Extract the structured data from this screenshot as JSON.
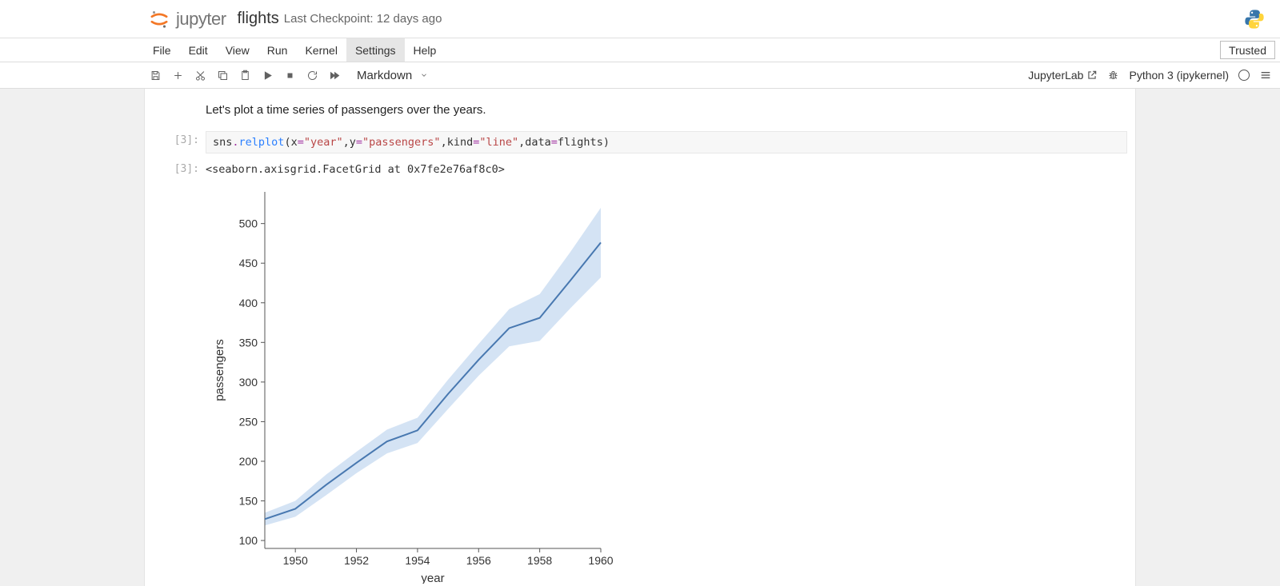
{
  "header": {
    "brand": "jupyter",
    "notebook_name": "flights",
    "checkpoint": "Last Checkpoint: 12 days ago"
  },
  "menu": {
    "items": [
      "File",
      "Edit",
      "View",
      "Run",
      "Kernel",
      "Settings",
      "Help"
    ],
    "active_index": 5,
    "trusted_label": "Trusted"
  },
  "toolbar": {
    "celltype_label": "Markdown",
    "jupyterlab_link": "JupyterLab",
    "kernel_name": "Python 3 (ipykernel)"
  },
  "cells": {
    "markdown_text": "Let's plot a time series of passengers over the years.",
    "in_prompt": "[3]:",
    "out_prompt": "[3]:",
    "code_tokens": {
      "p1": "sns",
      "p2": ".",
      "p3": "relplot",
      "p4": "(x",
      "p5": "=",
      "p6": "\"year\"",
      "p7": ",y",
      "p8": "=",
      "p9": "\"passengers\"",
      "p10": ",kind",
      "p11": "=",
      "p12": "\"line\"",
      "p13": ",data",
      "p14": "=",
      "p15": "flights)"
    },
    "output_text": "<seaborn.axisgrid.FacetGrid at 0x7fe2e76af8c0>"
  },
  "chart_data": {
    "type": "line",
    "xlabel": "year",
    "ylabel": "passengers",
    "x_ticks": [
      1950,
      1952,
      1954,
      1956,
      1958,
      1960
    ],
    "y_ticks": [
      100,
      150,
      200,
      250,
      300,
      350,
      400,
      450,
      500
    ],
    "x_range": [
      1949,
      1960
    ],
    "y_range": [
      90,
      540
    ],
    "series": [
      {
        "name": "passengers_mean",
        "x": [
          1949,
          1950,
          1951,
          1952,
          1953,
          1954,
          1955,
          1956,
          1957,
          1958,
          1959,
          1960
        ],
        "values": [
          127,
          140,
          170,
          198,
          225,
          239,
          285,
          328,
          368,
          381,
          428,
          476
        ]
      }
    ],
    "confidence_band": {
      "x": [
        1949,
        1950,
        1951,
        1952,
        1953,
        1954,
        1955,
        1956,
        1957,
        1958,
        1959,
        1960
      ],
      "upper": [
        135,
        150,
        183,
        212,
        240,
        255,
        303,
        348,
        392,
        411,
        464,
        520
      ],
      "lower": [
        119,
        130,
        157,
        185,
        210,
        223,
        266,
        308,
        345,
        352,
        393,
        432
      ]
    }
  }
}
